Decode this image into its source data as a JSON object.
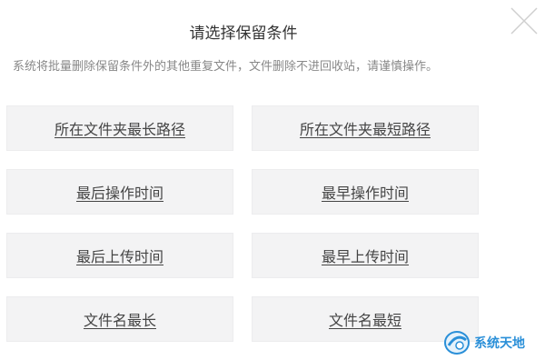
{
  "dialog": {
    "title": "请选择保留条件",
    "subtitle": "系统将批量删除保留条件外的其他重复文件，文件删除不进回收站，请谨慎操作。"
  },
  "options": [
    {
      "label": "所在文件夹最长路径"
    },
    {
      "label": "所在文件夹最短路径"
    },
    {
      "label": "最后操作时间"
    },
    {
      "label": "最早操作时间"
    },
    {
      "label": "最后上传时间"
    },
    {
      "label": "最早上传时间"
    },
    {
      "label": "文件名最长"
    },
    {
      "label": "文件名最短"
    }
  ],
  "watermark": {
    "text": "系统天地"
  },
  "icons": {
    "close": "close-icon",
    "watermark": "watermark-logo-icon"
  },
  "colors": {
    "option_bg": "#f3f3f4",
    "text": "#444444",
    "watermark": "#2a8fd8"
  }
}
